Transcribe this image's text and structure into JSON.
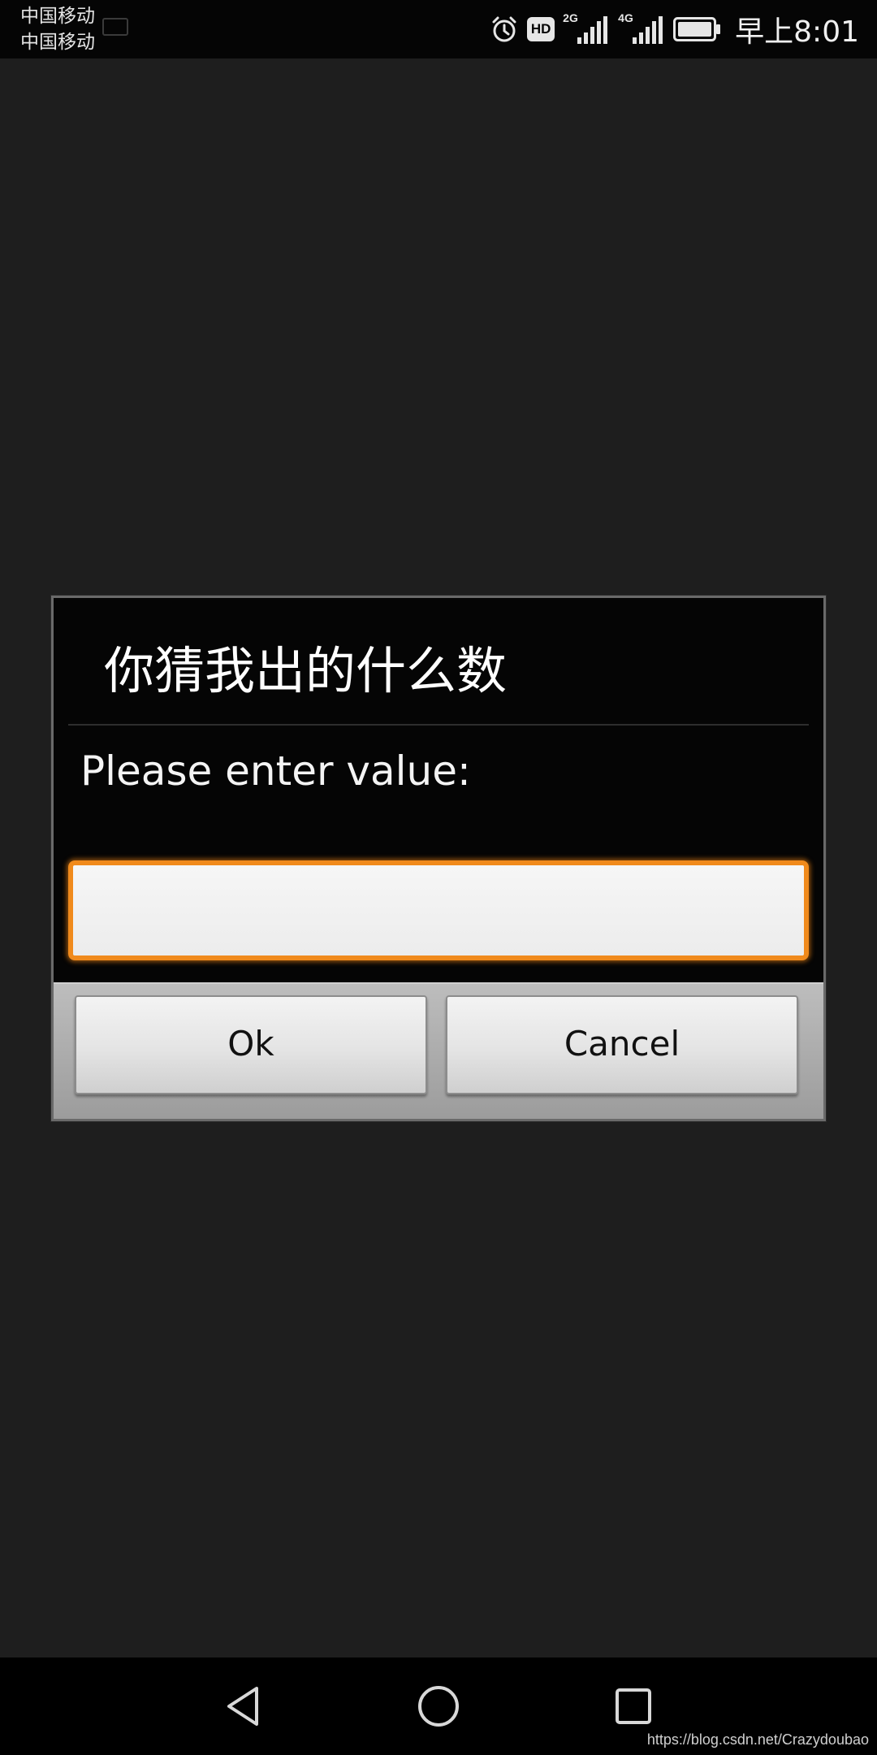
{
  "status_bar": {
    "carrier_1": "中国移动",
    "carrier_2": "中国移动",
    "hd_label": "HD",
    "signal_1_tag": "2G",
    "signal_2_tag": "4G",
    "time": "早上8:01",
    "icons": [
      "alarm-icon",
      "hd-icon",
      "signal-icon",
      "signal-icon",
      "battery-icon"
    ]
  },
  "dialog": {
    "title": "你猜我出的什么数",
    "message": "Please enter value:",
    "input_value": "",
    "ok_label": "Ok",
    "cancel_label": "Cancel",
    "accent_color": "#f08a1c"
  },
  "nav_bar": {
    "icons": [
      "back-icon",
      "home-icon",
      "recent-apps-icon"
    ]
  },
  "watermark": "https://blog.csdn.net/Crazydoubao"
}
